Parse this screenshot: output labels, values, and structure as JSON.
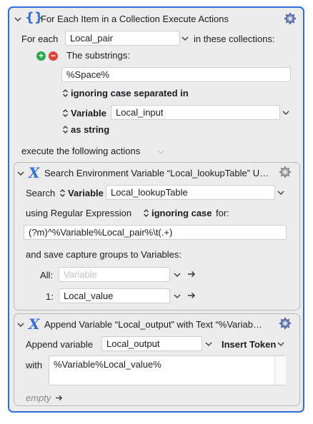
{
  "for_each": {
    "title": "For Each Item in a Collection Execute Actions",
    "for_each_label": "For each",
    "variable_value": "Local_pair",
    "in_collections_label": "in these collections:",
    "substrings_label": "The substrings:",
    "substrings_value": "%Space%",
    "ignoring_case_label": "ignoring case separated in",
    "variable_label": "Variable",
    "input_value": "Local_input",
    "as_string_label": "as string",
    "execute_label": "execute the following actions"
  },
  "search_action": {
    "title": "Search Environment Variable “Local_lookupTable” U…",
    "search_label": "Search",
    "variable_label": "Variable",
    "variable_value": "Local_lookupTable",
    "using_label": "using Regular Expression",
    "ignoring_case_label": "ignoring case",
    "for_label": "for:",
    "regex_value": "(?m)^%Variable%Local_pair%\\t(.+)",
    "save_label": "and save capture groups to Variables:",
    "all_label": "All:",
    "all_placeholder": "Variable",
    "one_label": "1:",
    "one_value": "Local_value"
  },
  "append_action": {
    "title": "Append Variable “Local_output” with Text “%Variab…",
    "append_label": "Append variable",
    "append_value": "Local_output",
    "insert_token_label": "Insert Token",
    "with_label": "with",
    "with_value": "%Variable%Local_value%",
    "empty_label": "empty"
  },
  "colors": {
    "accent": "#2f6fd6",
    "add_green": "#2aa84a",
    "remove_red": "#e0433a"
  },
  "icons": [
    "disclosure-chevron-icon",
    "braces-icon",
    "variable-x-icon",
    "gear-icon",
    "add-icon",
    "remove-icon",
    "stepper-icon",
    "arrow-right-icon"
  ]
}
